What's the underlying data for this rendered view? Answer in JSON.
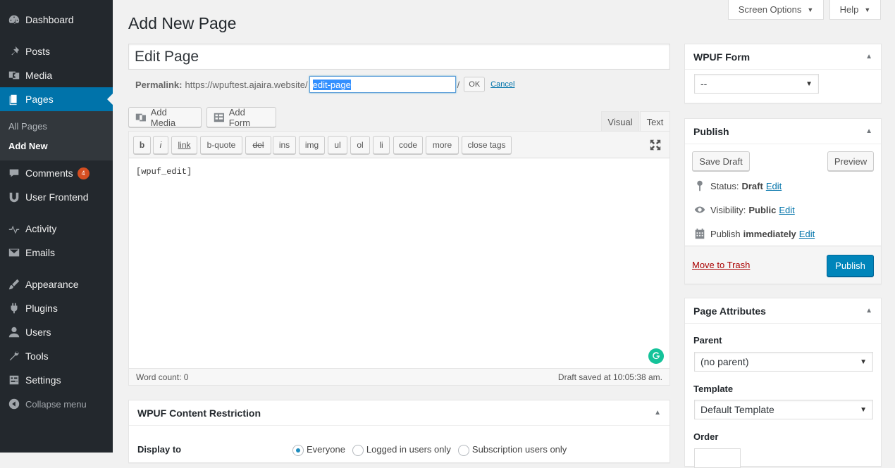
{
  "sidebar": {
    "items": [
      {
        "label": "Dashboard",
        "icon": "dashboard-icon"
      },
      {
        "label": "Posts",
        "icon": "pin-icon"
      },
      {
        "label": "Media",
        "icon": "media-icon"
      },
      {
        "label": "Pages",
        "icon": "pages-icon"
      },
      {
        "label": "Comments",
        "icon": "comment-icon",
        "badge": "4"
      },
      {
        "label": "User Frontend",
        "icon": "user-frontend-icon"
      },
      {
        "label": "Activity",
        "icon": "activity-icon"
      },
      {
        "label": "Emails",
        "icon": "email-icon"
      },
      {
        "label": "Appearance",
        "icon": "brush-icon"
      },
      {
        "label": "Plugins",
        "icon": "plugin-icon"
      },
      {
        "label": "Users",
        "icon": "users-icon"
      },
      {
        "label": "Tools",
        "icon": "wrench-icon"
      },
      {
        "label": "Settings",
        "icon": "settings-icon"
      }
    ],
    "submenu": [
      "All Pages",
      "Add New"
    ],
    "collapse_label": "Collapse menu"
  },
  "top_tabs": {
    "screen_options": "Screen Options",
    "help": "Help"
  },
  "header": {
    "title": "Add New Page"
  },
  "post_title": "Edit Page",
  "permalink": {
    "label": "Permalink:",
    "base_url": "https://wpuftest.ajaira.website/",
    "slug": "edit-page",
    "trailing": "/",
    "ok_label": "OK",
    "cancel_label": "Cancel"
  },
  "media_buttons": {
    "add_media": "Add Media",
    "add_form": "Add Form"
  },
  "editor_tabs": {
    "visual": "Visual",
    "text": "Text"
  },
  "quicktags": [
    "b",
    "i",
    "link",
    "b-quote",
    "del",
    "ins",
    "img",
    "ul",
    "ol",
    "li",
    "code",
    "more",
    "close tags"
  ],
  "editor": {
    "content": "[wpuf_edit]"
  },
  "status_bar": {
    "word_count": "Word count: 0",
    "draft_saved": "Draft saved at 10:05:38 am."
  },
  "wpuf_form_box": {
    "title": "WPUF Form",
    "selected": "--"
  },
  "publish_box": {
    "title": "Publish",
    "save_draft": "Save Draft",
    "preview": "Preview",
    "status_label": "Status:",
    "status_value": "Draft",
    "visibility_label": "Visibility:",
    "visibility_value": "Public",
    "publish_label": "Publish",
    "publish_value": "immediately",
    "edit_label": "Edit",
    "trash_label": "Move to Trash",
    "publish_button": "Publish"
  },
  "page_attributes": {
    "title": "Page Attributes",
    "parent_label": "Parent",
    "parent_value": "(no parent)",
    "template_label": "Template",
    "template_value": "Default Template",
    "order_label": "Order"
  },
  "content_restriction": {
    "title": "WPUF Content Restriction",
    "display_to_label": "Display to",
    "options": [
      "Everyone",
      "Logged in users only",
      "Subscription users only"
    ]
  },
  "colors": {
    "sidebar_bg": "#23282d",
    "accent": "#0073aa",
    "publish_button": "#0085ba",
    "badge": "#d54e21"
  }
}
